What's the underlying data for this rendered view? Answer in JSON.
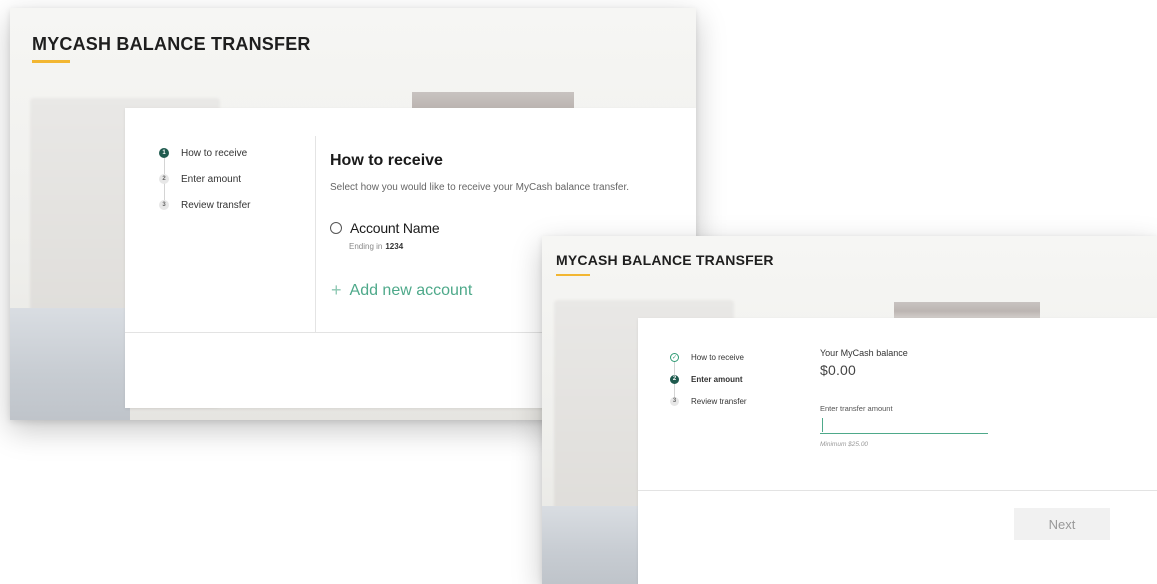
{
  "screen1": {
    "page_title": "MYCASH BALANCE TRANSFER",
    "steps": [
      {
        "number": "1",
        "label": "How to receive",
        "state": "active"
      },
      {
        "number": "2",
        "label": "Enter amount",
        "state": "pending"
      },
      {
        "number": "3",
        "label": "Review transfer",
        "state": "pending"
      }
    ],
    "title": "How to receive",
    "subtitle": "Select how you would like to receive your MyCash balance transfer.",
    "account": {
      "name": "Account Name",
      "ending_prefix": "Ending in",
      "ending_number": "1234"
    },
    "add_account": {
      "icon": "+",
      "label": "Add new account"
    }
  },
  "screen2": {
    "page_title": "MYCASH BALANCE TRANSFER",
    "steps": [
      {
        "number": "✓",
        "label": "How to receive",
        "state": "done"
      },
      {
        "number": "2",
        "label": "Enter amount",
        "state": "active"
      },
      {
        "number": "3",
        "label": "Review transfer",
        "state": "pending"
      }
    ],
    "balance_label": "Your MyCash balance",
    "balance_value": "$0.00",
    "input_label": "Enter transfer amount",
    "input_value": "",
    "min_note": "Minimum $25.00",
    "next_label": "Next"
  },
  "colors": {
    "accent_yellow": "#f2b632",
    "step_active": "#1f5a4e",
    "green_accent": "#4ea98a"
  }
}
